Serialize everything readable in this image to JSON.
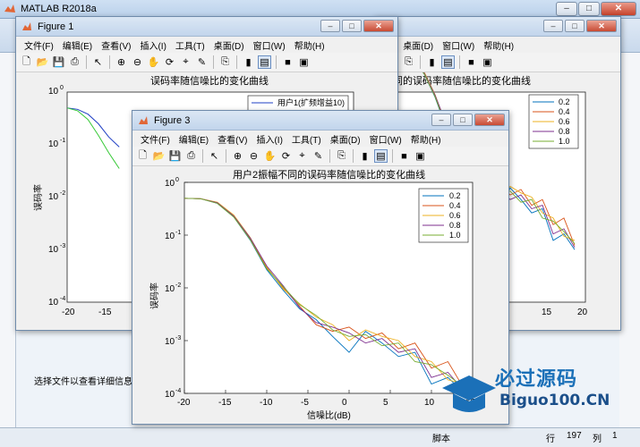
{
  "app": {
    "title": "MATLAB R2018a",
    "detail_text": "选择文件以查看详细信息",
    "status": {
      "script": "脚本",
      "row_label": "行",
      "row": "197",
      "col_label": "列",
      "col": "1"
    },
    "watermark": {
      "title": "必过源码",
      "subtitle": "Biguo100.CN"
    }
  },
  "menus": [
    "文件(F)",
    "编辑(E)",
    "查看(V)",
    "插入(I)",
    "工具(T)",
    "桌面(D)",
    "窗口(W)",
    "帮助(H)"
  ],
  "colors": {
    "series": [
      "#0072bd",
      "#d95319",
      "#edb120",
      "#7e2f8e",
      "#77ac30"
    ],
    "fig1_series": [
      "#1f3fc4",
      "#36c936"
    ]
  },
  "figure1": {
    "title": "Figure 1",
    "chart_title": "误码率随信噪比的变化曲线",
    "ylabel": "误码率",
    "yticks": [
      "10",
      "10",
      "10",
      "10"
    ],
    "yexps": [
      "0",
      "-1",
      "-2",
      "-3"
    ],
    "yexp_bottom": "-4",
    "xticks": [
      "-20",
      "-15"
    ],
    "legend": [
      "用户1(扩频增益10)"
    ]
  },
  "figure2": {
    "chart_title": "同的误码率随信噪比的变化曲线",
    "legend": [
      "0.2",
      "0.4",
      "0.6",
      "0.8",
      "1.0"
    ],
    "xticks": [
      "15",
      "20"
    ]
  },
  "figure3": {
    "title": "Figure 3",
    "chart_title": "用户2振幅不同的误码率随信噪比的变化曲线",
    "ylabel": "误码率",
    "xlabel": "信噪比(dB)",
    "xticks": [
      "-20",
      "-15",
      "-10",
      "-5",
      "0",
      "5",
      "10",
      "15"
    ],
    "ytick_base": "10",
    "yexps": [
      "0",
      "-1",
      "-2",
      "-3",
      "-4"
    ],
    "legend": [
      "0.2",
      "0.4",
      "0.6",
      "0.8",
      "1.0"
    ]
  },
  "chart_data": [
    {
      "type": "line",
      "title": "用户2振幅不同的误码率随信噪比的变化曲线",
      "xlabel": "信噪比(dB)",
      "ylabel": "误码率",
      "xlim": [
        -20,
        15
      ],
      "ylim": [
        0.0001,
        1
      ],
      "yscale": "log",
      "grid": false,
      "legend_position": "top-right",
      "x": [
        -20,
        -18,
        -16,
        -14,
        -12,
        -10,
        -8,
        -6,
        -4,
        -2,
        0,
        2,
        4,
        6,
        8,
        10,
        12,
        14
      ],
      "series": [
        {
          "name": "0.2",
          "values": [
            0.5,
            0.49,
            0.4,
            0.22,
            0.08,
            0.022,
            0.009,
            0.004,
            0.0025,
            0.0012,
            0.0006,
            0.0015,
            0.0009,
            0.0005,
            0.0006,
            0.00015,
            0.0002,
            0.0001
          ]
        },
        {
          "name": "0.4",
          "values": [
            0.5,
            0.49,
            0.41,
            0.23,
            0.085,
            0.024,
            0.01,
            0.0045,
            0.002,
            0.0015,
            0.0018,
            0.0011,
            0.0014,
            0.0007,
            0.0009,
            0.0003,
            0.0004,
            0.00012
          ]
        },
        {
          "name": "0.6",
          "values": [
            0.5,
            0.49,
            0.42,
            0.24,
            0.09,
            0.025,
            0.0095,
            0.005,
            0.0028,
            0.002,
            0.001,
            0.0016,
            0.0012,
            0.001,
            0.0005,
            0.0004,
            0.00018,
            0.00015
          ]
        },
        {
          "name": "0.8",
          "values": [
            0.5,
            0.49,
            0.41,
            0.23,
            0.088,
            0.026,
            0.011,
            0.0042,
            0.0022,
            0.0018,
            0.0014,
            0.0009,
            0.0011,
            0.0006,
            0.0007,
            0.0002,
            0.00025,
            0.00011
          ]
        },
        {
          "name": "1.0",
          "values": [
            0.5,
            0.49,
            0.4,
            0.22,
            0.082,
            0.023,
            0.0105,
            0.0048,
            0.003,
            0.0016,
            0.0012,
            0.0013,
            0.0008,
            0.0009,
            0.0004,
            0.00035,
            0.00022,
            0.00013
          ]
        }
      ]
    },
    {
      "type": "line",
      "title": "误码率随信噪比的变化曲线",
      "ylabel": "误码率",
      "yscale": "log",
      "xlim": [
        -20,
        -10
      ],
      "ylim": [
        0.0001,
        1
      ],
      "x": [
        -20,
        -18,
        -16,
        -14,
        -12,
        -10
      ],
      "series": [
        {
          "name": "用户1(扩频增益10)",
          "values": [
            0.5,
            0.47,
            0.38,
            0.25,
            0.14,
            0.09
          ]
        },
        {
          "values": [
            0.5,
            0.44,
            0.3,
            0.15,
            0.07,
            0.035
          ]
        }
      ]
    }
  ]
}
